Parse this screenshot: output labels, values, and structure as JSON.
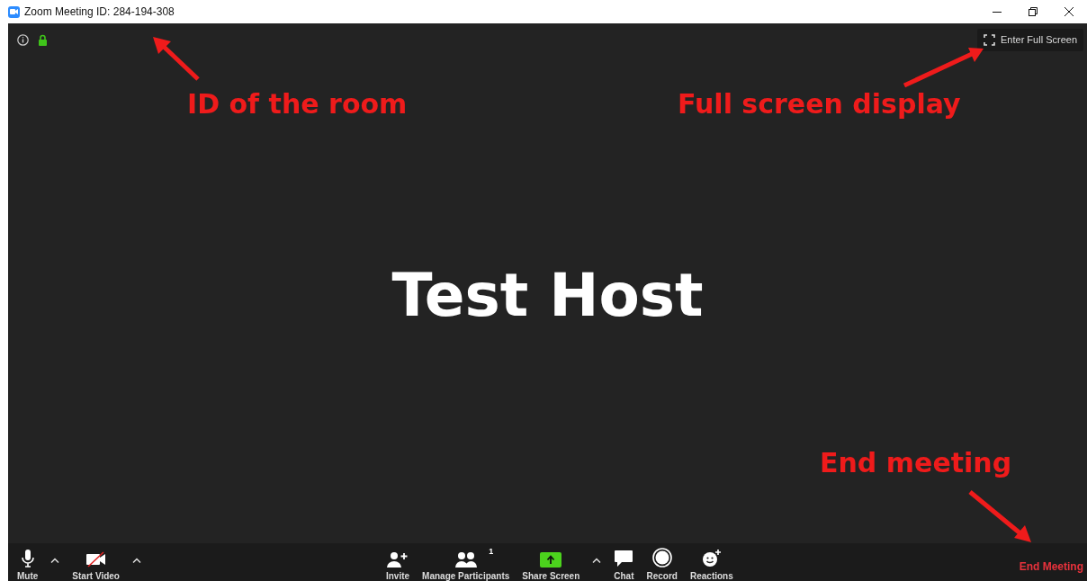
{
  "window": {
    "title": "Zoom Meeting ID: 284-194-308"
  },
  "meeting_bar": {
    "full_screen_button": "Enter Full Screen"
  },
  "video": {
    "participant_name": "Test Host"
  },
  "toolbar": {
    "left": [
      {
        "kind": "mic",
        "label": "Mute"
      },
      {
        "kind": "caret"
      },
      {
        "kind": "video-off",
        "label": "Start Video"
      },
      {
        "kind": "caret"
      }
    ],
    "center": [
      {
        "kind": "invite",
        "label": "Invite"
      },
      {
        "kind": "participants",
        "label": "Manage Participants",
        "count": "1"
      },
      {
        "kind": "share",
        "label": "Share Screen"
      },
      {
        "kind": "caret"
      },
      {
        "kind": "chat",
        "label": "Chat"
      },
      {
        "kind": "record",
        "label": "Record"
      },
      {
        "kind": "reactions",
        "label": "Reactions"
      }
    ],
    "end_button": "End Meeting"
  },
  "annotations": [
    {
      "text": "ID of the room"
    },
    {
      "text": "Full screen display"
    },
    {
      "text": "End meeting"
    }
  ]
}
